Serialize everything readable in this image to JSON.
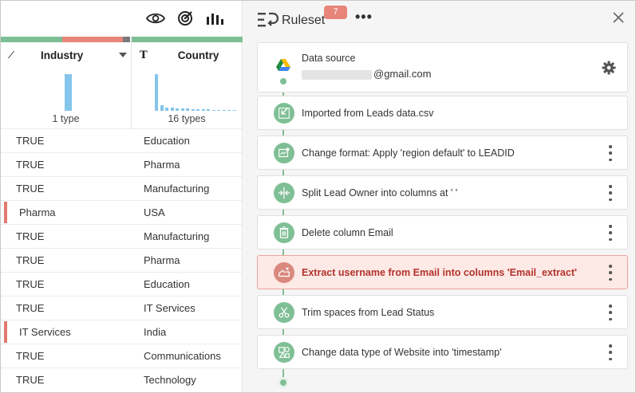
{
  "grid": {
    "toolbar_icons": [
      "eye-icon",
      "target-icon",
      "histogram-icon"
    ],
    "quality_colors": {
      "ok": "#7dbf95",
      "error": "#e8857a",
      "muted": "#7a7a7a"
    },
    "columns": [
      {
        "type_icon": "boolean-type-icon",
        "type_glyph": "⁄",
        "name": "Industry",
        "type_count": "1 type"
      },
      {
        "type_icon": "text-type-icon",
        "type_glyph": "T",
        "name": "Country",
        "type_count": "16 types"
      }
    ],
    "histogram_color": "#85c5ec",
    "country_histogram": [
      1.0,
      0.16,
      0.09,
      0.08,
      0.07,
      0.06,
      0.06,
      0.05,
      0.05,
      0.04,
      0.04,
      0.03,
      0.03,
      0.02,
      0.02,
      0.02
    ],
    "rows": [
      {
        "c1": "TRUE",
        "c2": "Education",
        "error": false
      },
      {
        "c1": "TRUE",
        "c2": "Pharma",
        "error": false
      },
      {
        "c1": "TRUE",
        "c2": "Manufacturing",
        "error": false
      },
      {
        "c1": "Pharma",
        "c2": "USA",
        "error": true
      },
      {
        "c1": "TRUE",
        "c2": "Manufacturing",
        "error": false
      },
      {
        "c1": "TRUE",
        "c2": "Pharma",
        "error": false
      },
      {
        "c1": "TRUE",
        "c2": "Education",
        "error": false
      },
      {
        "c1": "TRUE",
        "c2": "IT Services",
        "error": false
      },
      {
        "c1": "IT Services",
        "c2": "India",
        "error": true
      },
      {
        "c1": "TRUE",
        "c2": "Communications",
        "error": false
      },
      {
        "c1": "TRUE",
        "c2": "Technology",
        "error": false
      }
    ]
  },
  "ruleset": {
    "title": "Ruleset",
    "badge": "7",
    "more_glyph": "•••",
    "accent": "#7fbf95",
    "error_accent": "#d9897e",
    "source": {
      "label": "Data source",
      "email": "@gmail.com"
    },
    "steps": [
      {
        "icon": "import-icon",
        "label": "Imported from Leads data.csv",
        "menu": false,
        "error": false
      },
      {
        "icon": "format-icon",
        "label": "Change format: Apply 'region default' to LEADID",
        "menu": true,
        "error": false
      },
      {
        "icon": "split-icon",
        "label": "Split Lead Owner into columns at ' '",
        "menu": true,
        "error": false
      },
      {
        "icon": "trash-icon",
        "label": "Delete column Email",
        "menu": true,
        "error": false
      },
      {
        "icon": "extract-icon",
        "label": "Extract username from Email into columns 'Email_extract'",
        "menu": true,
        "error": true
      },
      {
        "icon": "scissors-icon",
        "label": "Trim spaces from Lead Status",
        "menu": true,
        "error": false
      },
      {
        "icon": "shapes-icon",
        "label": "Change data type of Website into 'timestamp'",
        "menu": true,
        "error": false
      }
    ]
  }
}
